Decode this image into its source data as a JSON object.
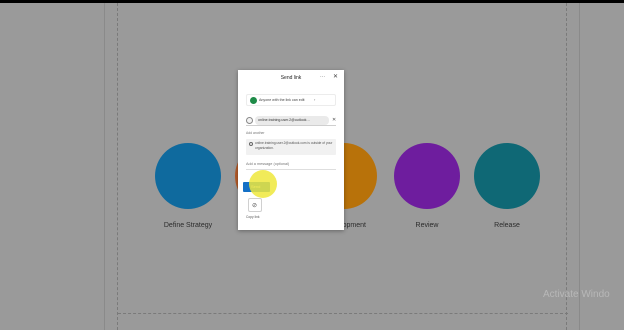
{
  "slide": {
    "steps": [
      {
        "label": "Define Strategy",
        "color": "#0f6a9e"
      },
      {
        "label": "",
        "color": "#b55b28"
      },
      {
        "label": "…lopment",
        "color": "#b8720a"
      },
      {
        "label": "Review",
        "color": "#6e1d9e"
      },
      {
        "label": "Release",
        "color": "#0f6875"
      }
    ]
  },
  "watermark": "Activate Windo",
  "dialog": {
    "title": "Send link",
    "more_label": "···",
    "close_label": "✕",
    "scope_text": "Anyone with the link can edit",
    "scope_chevron": "›",
    "recipient": "online.training.user.2@outlook…",
    "remove_label": "✕",
    "add_another": "Add another",
    "warning": "online.training.user.2@outlook.com is outside of your organization.",
    "message_placeholder": "Add a message (optional)",
    "send_label": "Send",
    "copy_label": "Copy link",
    "link_glyph": "⊘"
  },
  "icons": [
    "globe-icon",
    "avatar-icon",
    "info-icon",
    "link-icon",
    "close-icon",
    "more-icon"
  ]
}
